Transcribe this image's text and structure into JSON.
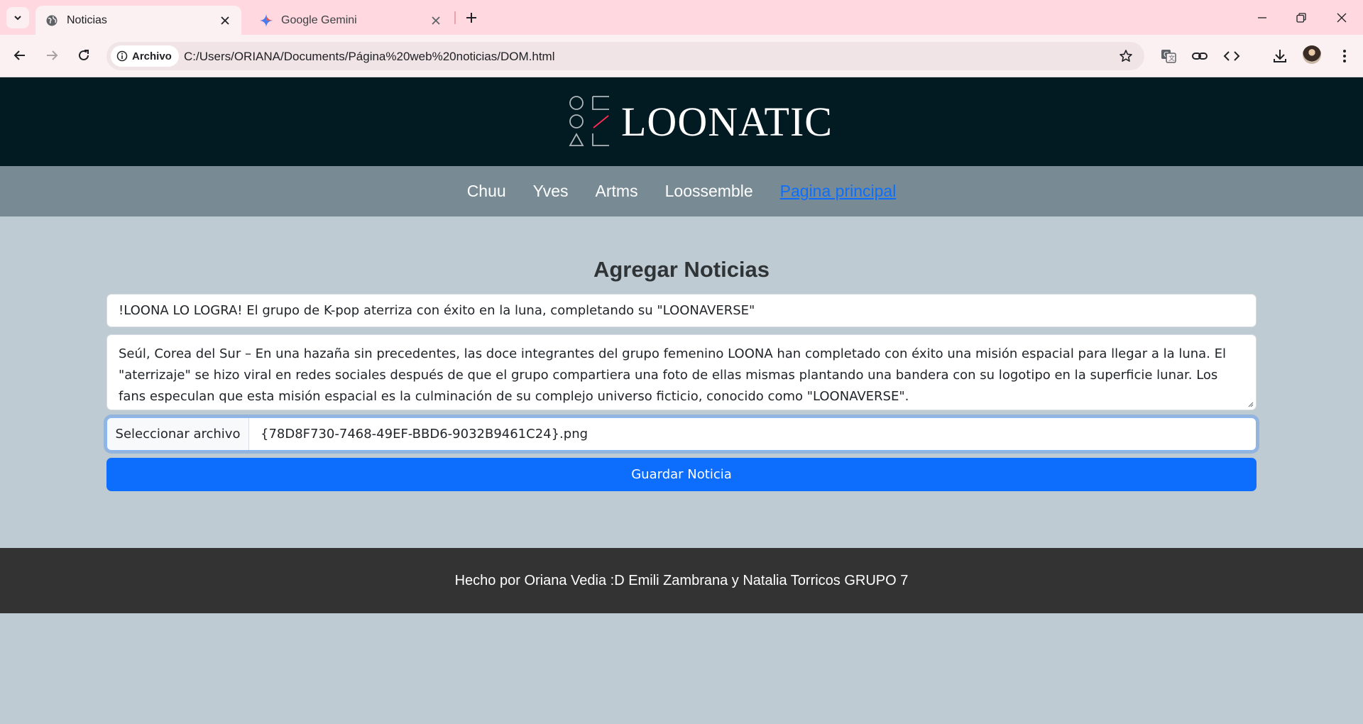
{
  "browser": {
    "tabs": [
      {
        "title": "Noticias",
        "icon": "globe-icon",
        "active": true
      },
      {
        "title": "Google Gemini",
        "icon": "gemini-sparkle-icon",
        "active": false
      }
    ],
    "site_chip_label": "Archivo",
    "url": "C:/Users/ORIANA/Documents/Página%20web%20noticias/DOM.html"
  },
  "header": {
    "logo_text": "LOONATIC",
    "colors": {
      "background": "#021a22",
      "logo_accent": "#ff2d55"
    }
  },
  "nav": {
    "items": [
      "Chuu",
      "Yves",
      "Artms",
      "Loossemble"
    ],
    "main_link": "Pagina principal"
  },
  "form": {
    "heading": "Agregar Noticias",
    "title_value": "!LOONA LO LOGRA! El grupo de K-pop aterriza con éxito en la luna, completando su \"LOONAVERSE\"",
    "body_value": "Seúl, Corea del Sur – En una hazaña sin precedentes, las doce integrantes del grupo femenino LOONA han completado con éxito una misión espacial para llegar a la luna. El \"aterrizaje\" se hizo viral en redes sociales después de que el grupo compartiera una foto de ellas mismas plantando una bandera con su logotipo en la superficie lunar. Los fans especulan que esta misión espacial es la culminación de su complejo universo ficticio, conocido como \"LOONAVERSE\".",
    "file_button_label": "Seleccionar archivo",
    "file_name": "{78D8F730-7468-49EF-BBD6-9032B9461C24}.png",
    "submit_label": "Guardar Noticia",
    "colors": {
      "primary": "#0d6efd"
    }
  },
  "footer": {
    "text": "Hecho por Oriana Vedia :D Emili Zambrana y Natalia Torricos GRUPO 7"
  }
}
